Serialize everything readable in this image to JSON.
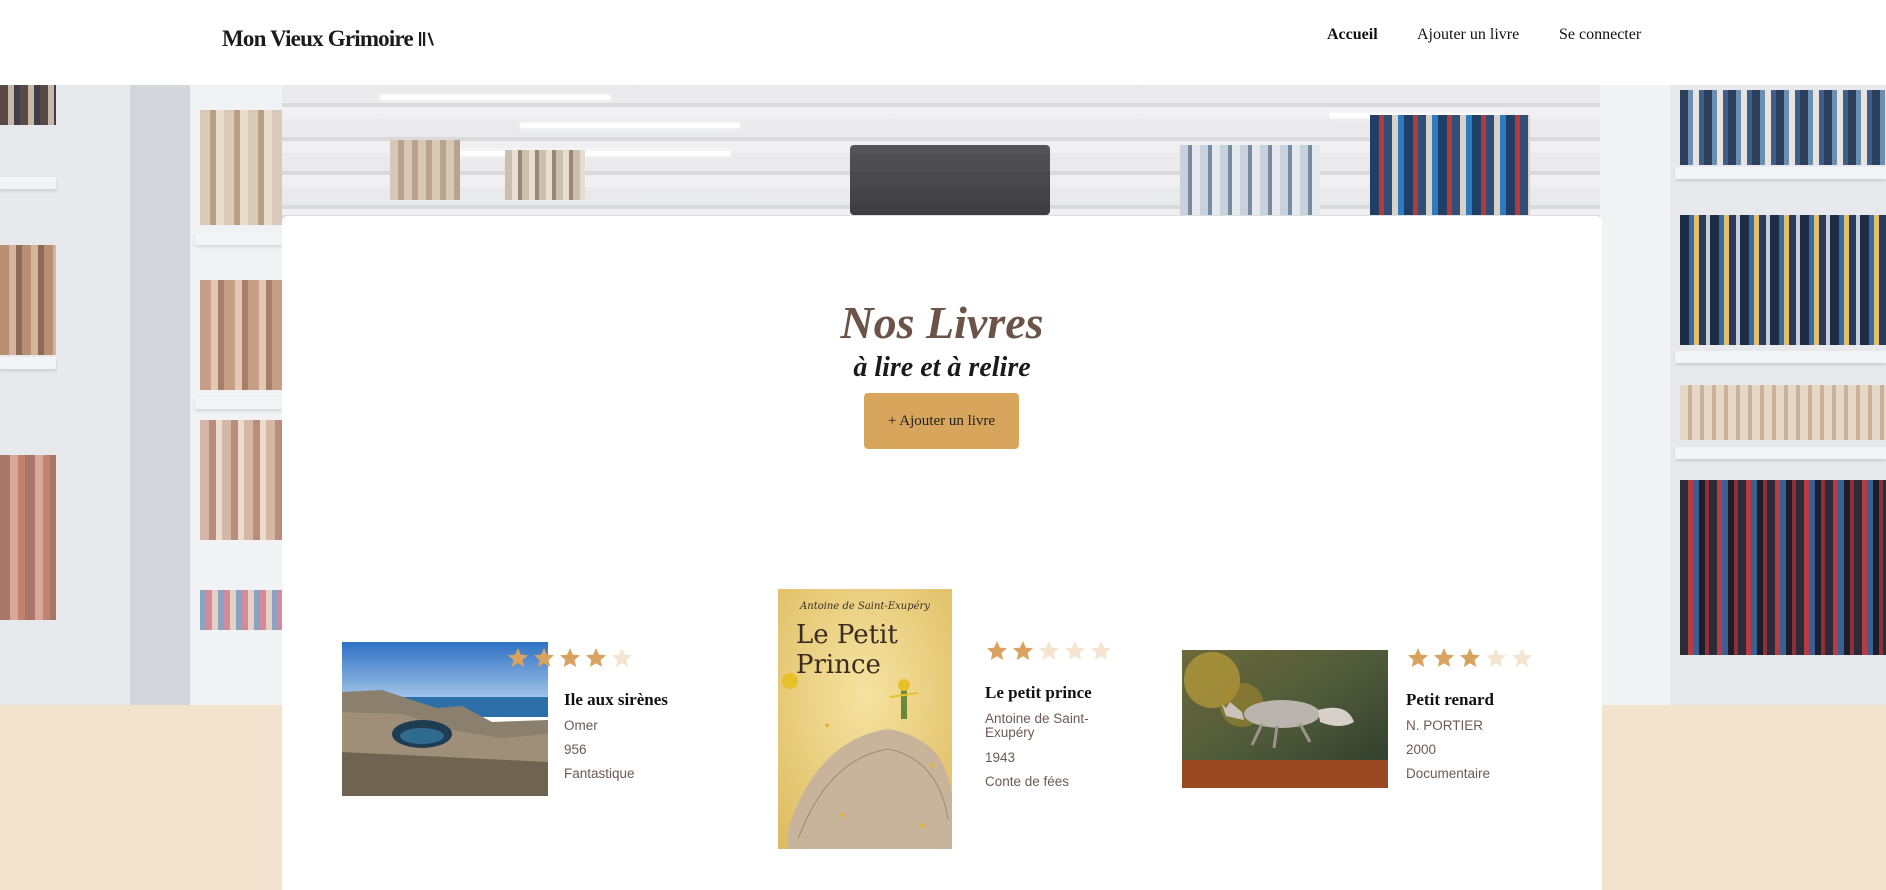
{
  "header": {
    "logo_text": "Mon Vieux Grimoire",
    "logo_icon": "books-icon",
    "nav": [
      {
        "label": "Accueil",
        "active": true
      },
      {
        "label": "Ajouter un livre",
        "active": false
      },
      {
        "label": "Se connecter",
        "active": false
      }
    ]
  },
  "main": {
    "title": "Nos Livres",
    "subtitle": "à lire et à relire",
    "add_button": "+ Ajouter un livre"
  },
  "books": [
    {
      "title": "Ile aux sirènes",
      "author": "Omer",
      "year": "956",
      "genre": "Fantastique",
      "rating": 4,
      "image": "coastline-rocks-image"
    },
    {
      "title": "Le petit prince",
      "author": "Antoine de Saint-Exupéry",
      "year": "1943",
      "genre": "Conte de fées",
      "rating": 2,
      "image": "petit-prince-cover-image",
      "cover_author": "Antoine de Saint-Exupéry",
      "cover_title_line1": "Le Petit",
      "cover_title_line2": "Prince"
    },
    {
      "title": "Petit renard",
      "author": "N. PORTIER",
      "year": "2000",
      "genre": "Documentaire",
      "rating": 3,
      "image": "fox-jumping-image"
    }
  ],
  "colors": {
    "accent": "#d8a55c",
    "star_filled": "#d9a25f",
    "star_empty": "#f4e4d0",
    "title": "#6b5347",
    "background": "#f2e3cf"
  }
}
